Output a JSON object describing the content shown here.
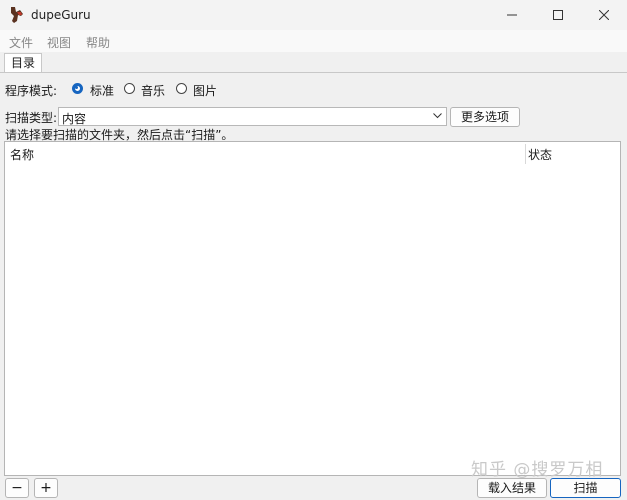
{
  "window": {
    "title": "dupeGuru",
    "controls": {
      "minimize": "minimize-icon",
      "maximize": "maximize-icon",
      "close": "close-icon"
    }
  },
  "menu": {
    "items": [
      "文件",
      "视图",
      "帮助"
    ]
  },
  "tabs": [
    {
      "label": "目录",
      "active": true
    }
  ],
  "mode": {
    "label": "程序模式:",
    "options": [
      {
        "label": "标准",
        "checked": true
      },
      {
        "label": "音乐",
        "checked": false
      },
      {
        "label": "图片",
        "checked": false
      }
    ]
  },
  "scan_type": {
    "label": "扫描类型:",
    "value": "内容"
  },
  "buttons": {
    "more_options": "更多选项",
    "add": "+",
    "remove": "−",
    "load_results": "载入结果",
    "scan": "扫描"
  },
  "instruction": "请选择要扫描的文件夹，然后点击“扫描”。",
  "table": {
    "columns": [
      "名称",
      "状态"
    ],
    "rows": []
  },
  "watermark": "知乎 @搜罗万相",
  "colors": {
    "accent": "#1665c0",
    "background": "#f0f0f0"
  }
}
